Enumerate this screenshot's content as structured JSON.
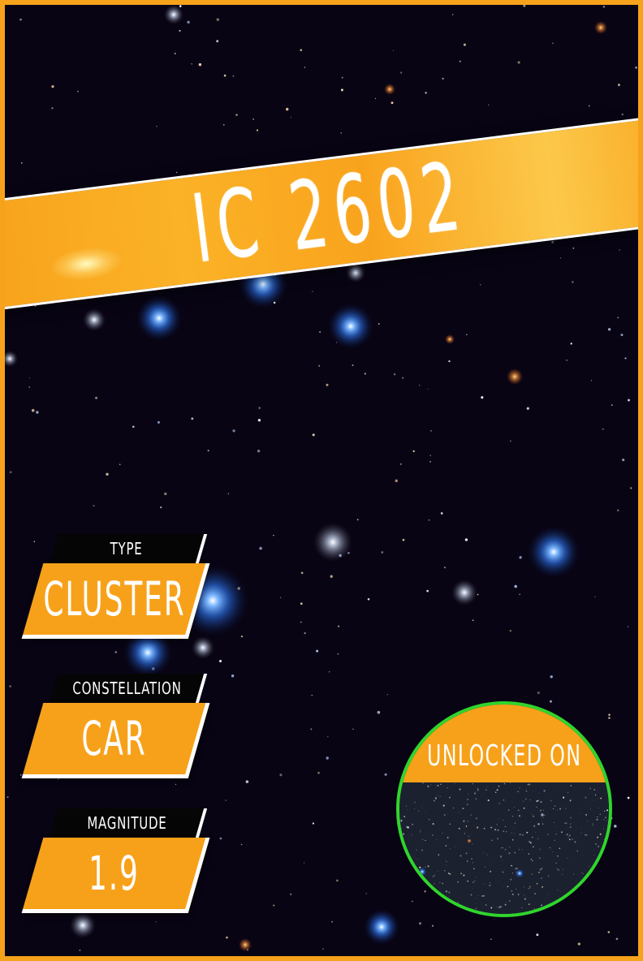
{
  "title": "IC 2602",
  "info": {
    "type": {
      "label": "TYPE",
      "value": "CLUSTER"
    },
    "constellation": {
      "label": "CONSTELLATION",
      "value": "CAR"
    },
    "magnitude": {
      "label": "MAGNITUDE",
      "value": "1.9"
    }
  },
  "badge": {
    "label": "UNLOCKED ON",
    "border_color": "#30d52c"
  },
  "colors": {
    "accent": "#f7a11a",
    "background": "#080414",
    "text": "#ffffff"
  }
}
